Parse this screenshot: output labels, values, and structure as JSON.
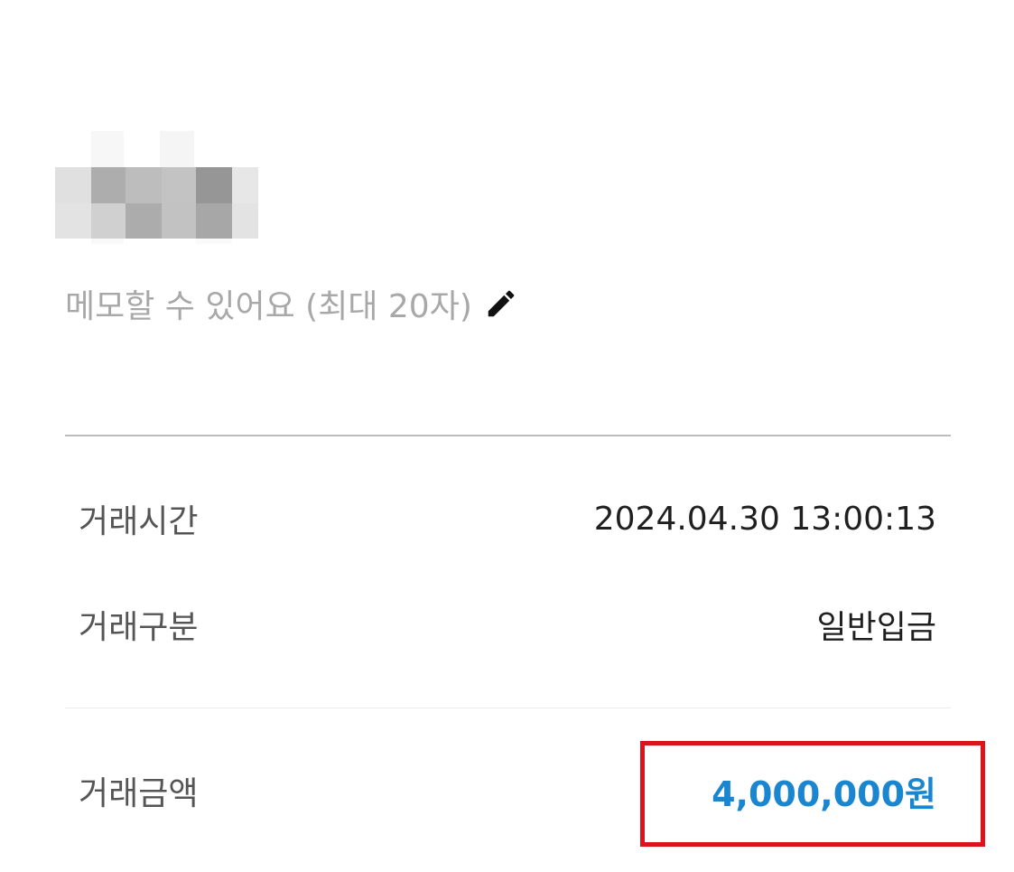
{
  "memo": {
    "placeholder": "메모할 수 있어요 (최대 20자)",
    "edit_icon": "pencil-icon"
  },
  "details": {
    "time": {
      "label": "거래시간",
      "value": "2024.04.30 13:00:13"
    },
    "type": {
      "label": "거래구분",
      "value": "일반입금"
    },
    "amount": {
      "label": "거래금액",
      "value": "4,000,000원"
    }
  },
  "colors": {
    "amount": "#1a86d0",
    "highlight_border": "#d9141c",
    "placeholder": "#a8a8a8"
  }
}
